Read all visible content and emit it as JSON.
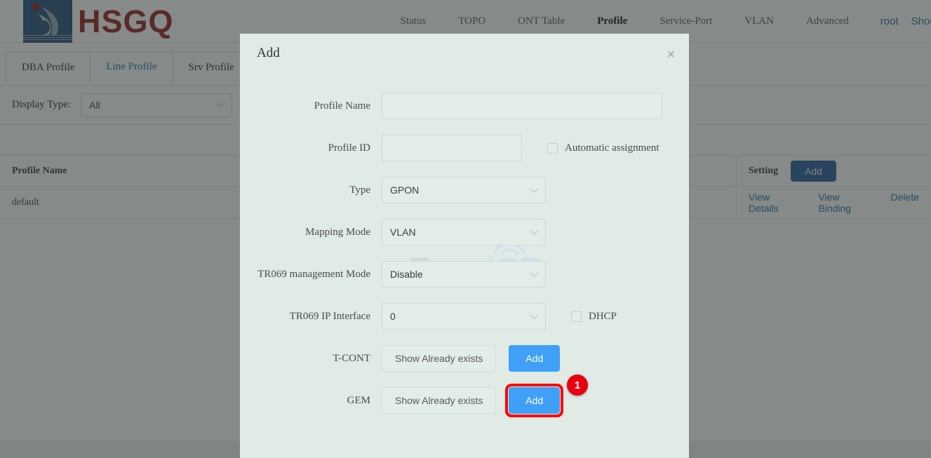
{
  "brand": {
    "name": "HSGQ",
    "logo_icon": "hsgq-flame-logo-icon"
  },
  "nav": {
    "items": [
      {
        "label": "Status",
        "active": false
      },
      {
        "label": "TOPO",
        "active": false
      },
      {
        "label": "ONT Table",
        "active": false
      },
      {
        "label": "Profile",
        "active": true
      },
      {
        "label": "Service-Port",
        "active": false
      },
      {
        "label": "VLAN",
        "active": false
      },
      {
        "label": "Advanced",
        "active": false
      }
    ],
    "user": "root",
    "shortcut": "Shortcut",
    "shortcut_icon": "chevron-down-icon"
  },
  "tabs": [
    {
      "label": "DBA Profile",
      "active": false
    },
    {
      "label": "Line Profile",
      "active": true
    },
    {
      "label": "Srv Profile",
      "active": false
    }
  ],
  "filter": {
    "label": "Display Type:",
    "value": "All",
    "caret_icon": "chevron-down-icon"
  },
  "table": {
    "columns": [
      "Profile Name",
      "Setting"
    ],
    "header_add_label": "Add",
    "rows": [
      {
        "profile_name": "default",
        "actions": [
          "View Details",
          "View Binding",
          "Delete"
        ]
      }
    ]
  },
  "modal": {
    "title": "Add",
    "close_icon": "close-icon",
    "fields": {
      "profile_name": {
        "label": "Profile Name",
        "value": "",
        "placeholder": ""
      },
      "profile_id": {
        "label": "Profile ID",
        "value": "",
        "placeholder": ""
      },
      "automatic_assignment": {
        "label": "Automatic assignment",
        "checked": false
      },
      "type": {
        "label": "Type",
        "value": "GPON"
      },
      "mapping_mode": {
        "label": "Mapping Mode",
        "value": "VLAN"
      },
      "tr069_management_mode": {
        "label": "TR069 management Mode",
        "value": "Disable"
      },
      "tr069_ip_interface": {
        "label": "TR069 IP Interface",
        "value": "0"
      },
      "dhcp": {
        "label": "DHCP",
        "checked": false
      },
      "tcont": {
        "label": "T-CONT",
        "show_label": "Show Already exists",
        "add_label": "Add"
      },
      "gem": {
        "label": "GEM",
        "show_label": "Show Already exists",
        "add_label": "Add"
      }
    }
  },
  "annotation": {
    "step_badge": "1",
    "highlight_color": "#ff0000",
    "badge_color": "#e60012"
  },
  "watermark": {
    "part1": "Foro",
    "part2": "iSP"
  },
  "colors": {
    "brand_red": "#9b2420",
    "brand_blue": "#2b5080",
    "link_blue": "#2e6da4",
    "accent_blue": "#40a0f8",
    "modal_bg": "#dfebe4"
  }
}
